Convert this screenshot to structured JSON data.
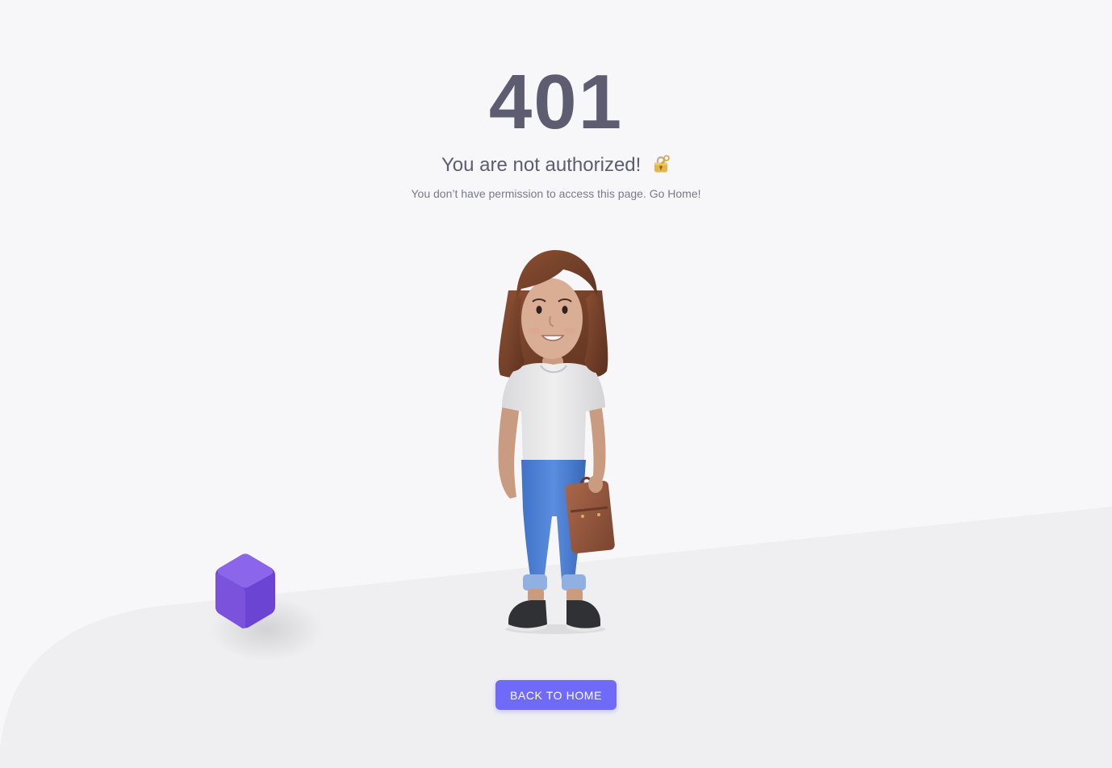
{
  "error": {
    "code": "401",
    "title": "You are not authorized!",
    "subtitle": "You don’t have permission to access this page. Go Home!"
  },
  "actions": {
    "back_home_label": "BACK TO HOME"
  },
  "icons": {
    "title_icon": "lock-with-key-icon",
    "illustration": "woman-with-briefcase-illustration",
    "decoration": "purple-cube-icon"
  },
  "colors": {
    "background": "#f7f7fa",
    "floor": "#efeff2",
    "text_primary": "#5d5c70",
    "text_secondary": "#7a7989",
    "accent": "#6f6af8",
    "cube": "#7d55e0"
  }
}
